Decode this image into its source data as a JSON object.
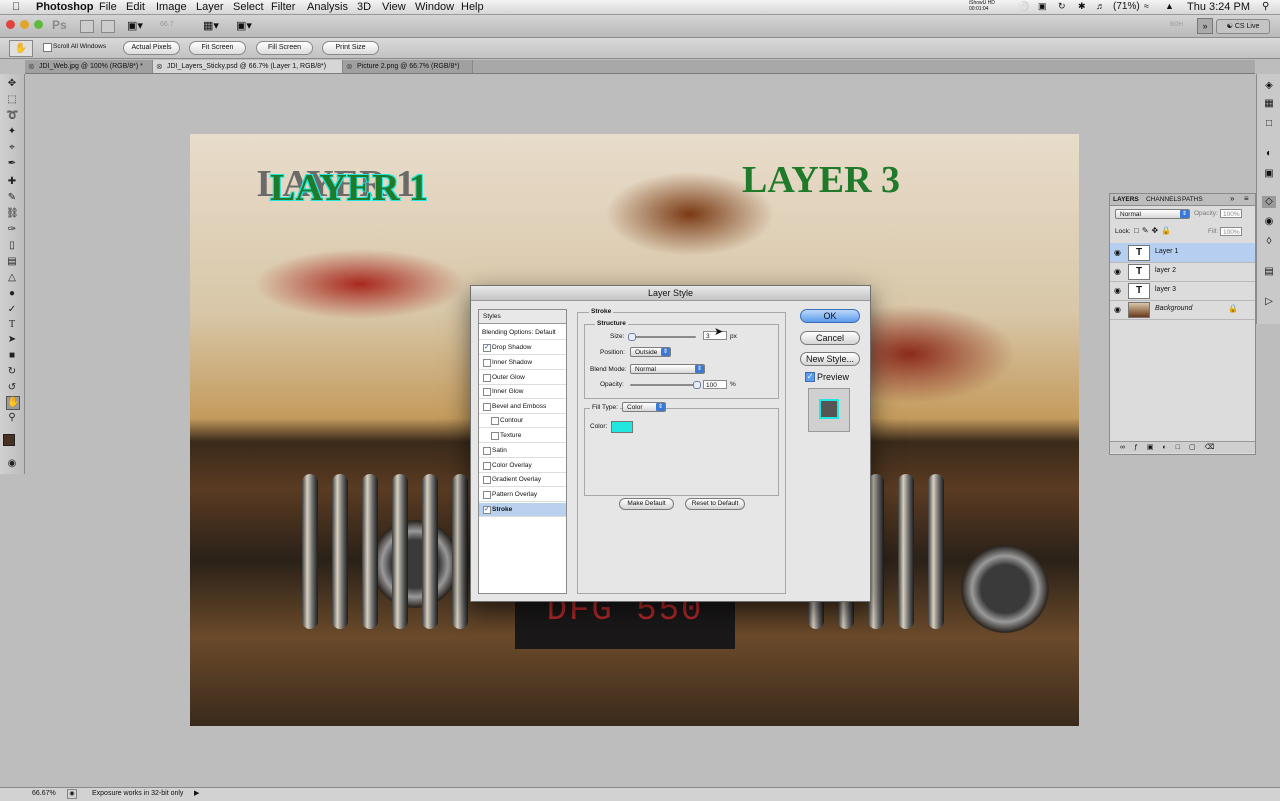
{
  "menubar": {
    "app": "Photoshop",
    "items": [
      "File",
      "Edit",
      "Image",
      "Layer",
      "Select",
      "Filter",
      "Analysis",
      "3D",
      "View",
      "Window",
      "Help"
    ],
    "status_top": "iShowU HD",
    "status_time_small": "00:01:04",
    "battery": "(71%)",
    "clock": "Thu 3:24 PM"
  },
  "appbar": {
    "logo": "Ps",
    "cslive": "CS Live",
    "zoom_indicator": "66.7",
    "hint": "BOH"
  },
  "options": {
    "scroll_all": "Scroll All Windows",
    "actual_pixels": "Actual Pixels",
    "fit_screen": "Fit Screen",
    "fill_screen": "Fill Screen",
    "print_size": "Print Size"
  },
  "tabs": [
    {
      "label": "JDI_Web.jpg @ 100% (RGB/8*) *"
    },
    {
      "label": "JDI_Layers_Sticky.psd @ 66.7% (Layer 1, RGB/8*)"
    },
    {
      "label": "Picture 2.png @ 66.7% (RGB/8*)"
    }
  ],
  "canvas": {
    "text_left_ghost": "LAYER 1",
    "text_left": "LAYER 1",
    "text_right": "LAYER 3",
    "plate": "DFG 550",
    "text_color_green": "#1f7a2a",
    "stroke_color": "#22e6e0"
  },
  "layers_panel": {
    "tabs": [
      "LAYERS",
      "CHANNELS",
      "PATHS"
    ],
    "blend": "Normal",
    "opacity_label": "Opacity:",
    "opacity_value": "100%",
    "lock_label": "Lock:",
    "fill_label": "Fill:",
    "fill_value": "100%",
    "layers": [
      {
        "name": "Layer 1",
        "thumb": "T"
      },
      {
        "name": "layer 2",
        "thumb": "T"
      },
      {
        "name": "layer 3",
        "thumb": "T"
      },
      {
        "name": "Background",
        "thumb": ""
      }
    ]
  },
  "dialog": {
    "title": "Layer Style",
    "styles_header": "Styles",
    "blending_options": "Blending Options: Default",
    "effects": [
      {
        "label": "Drop Shadow",
        "checked": true
      },
      {
        "label": "Inner Shadow",
        "checked": false
      },
      {
        "label": "Outer Glow",
        "checked": false
      },
      {
        "label": "Inner Glow",
        "checked": false
      },
      {
        "label": "Bevel and Emboss",
        "checked": false
      },
      {
        "label": "Contour",
        "checked": false
      },
      {
        "label": "Texture",
        "checked": false
      },
      {
        "label": "Satin",
        "checked": false
      },
      {
        "label": "Color Overlay",
        "checked": false
      },
      {
        "label": "Gradient Overlay",
        "checked": false
      },
      {
        "label": "Pattern Overlay",
        "checked": false
      },
      {
        "label": "Stroke",
        "checked": true
      }
    ],
    "section_title": "Stroke",
    "structure_title": "Structure",
    "size_label": "Size:",
    "size_value": "3",
    "size_unit": "px",
    "position_label": "Position:",
    "position_value": "Outside",
    "blend_mode_label": "Blend Mode:",
    "blend_mode_value": "Normal",
    "opacity_label": "Opacity:",
    "opacity_value": "100",
    "opacity_unit": "%",
    "fill_type_label": "Fill Type:",
    "fill_type_value": "Color",
    "color_label": "Color:",
    "make_default": "Make Default",
    "reset_default": "Reset to Default",
    "ok": "OK",
    "cancel": "Cancel",
    "new_style": "New Style...",
    "preview_label": "Preview",
    "preview_checked": true
  },
  "status": {
    "zoom": "66.67%",
    "message": "Exposure works in 32-bit only"
  }
}
